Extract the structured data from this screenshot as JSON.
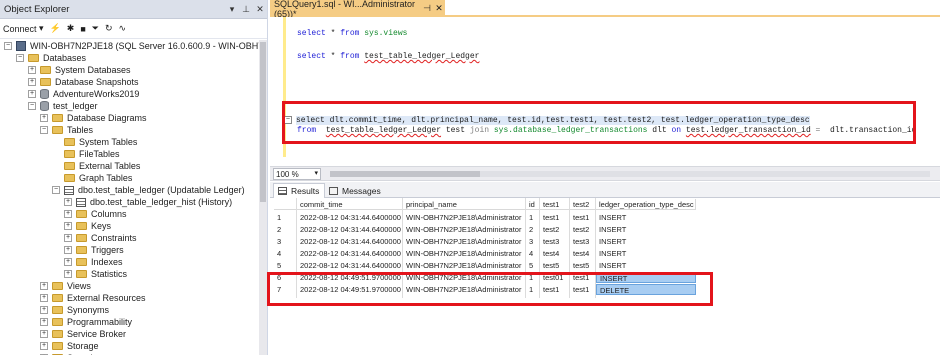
{
  "object_explorer": {
    "title": "Object Explorer",
    "connect_label": "Connect",
    "tree": [
      {
        "label": "WIN-OBH7N2PJE18 (SQL Server 16.0.600.9 - WIN-OBH7N2PJE18\\",
        "icon": "server-icon",
        "toggle": "−"
      },
      {
        "label": "Databases",
        "icon": "folder-icon",
        "toggle": "−"
      },
      {
        "label": "System Databases",
        "icon": "folder-icon",
        "toggle": "+"
      },
      {
        "label": "Database Snapshots",
        "icon": "folder-icon",
        "toggle": "+"
      },
      {
        "label": "AdventureWorks2019",
        "icon": "database-icon",
        "toggle": "+"
      },
      {
        "label": "test_ledger",
        "icon": "database-icon",
        "toggle": "−"
      },
      {
        "label": "Database Diagrams",
        "icon": "folder-icon",
        "toggle": "+"
      },
      {
        "label": "Tables",
        "icon": "folder-icon",
        "toggle": "−"
      },
      {
        "label": "System Tables",
        "icon": "folder-icon",
        "toggle": ""
      },
      {
        "label": "FileTables",
        "icon": "folder-icon",
        "toggle": ""
      },
      {
        "label": "External Tables",
        "icon": "folder-icon",
        "toggle": ""
      },
      {
        "label": "Graph Tables",
        "icon": "folder-icon",
        "toggle": ""
      },
      {
        "label": "dbo.test_table_ledger (Updatable Ledger)",
        "icon": "table-icon",
        "toggle": "−"
      },
      {
        "label": "dbo.test_table_ledger_hist (History)",
        "icon": "table-icon",
        "toggle": "+"
      },
      {
        "label": "Columns",
        "icon": "folder-icon",
        "toggle": "+"
      },
      {
        "label": "Keys",
        "icon": "folder-icon",
        "toggle": "+"
      },
      {
        "label": "Constraints",
        "icon": "folder-icon",
        "toggle": "+"
      },
      {
        "label": "Triggers",
        "icon": "folder-icon",
        "toggle": "+"
      },
      {
        "label": "Indexes",
        "icon": "folder-icon",
        "toggle": "+"
      },
      {
        "label": "Statistics",
        "icon": "folder-icon",
        "toggle": "+"
      },
      {
        "label": "Views",
        "icon": "folder-icon",
        "toggle": "+"
      },
      {
        "label": "External Resources",
        "icon": "folder-icon",
        "toggle": "+"
      },
      {
        "label": "Synonyms",
        "icon": "folder-icon",
        "toggle": "+"
      },
      {
        "label": "Programmability",
        "icon": "folder-icon",
        "toggle": "+"
      },
      {
        "label": "Service Broker",
        "icon": "folder-icon",
        "toggle": "+"
      },
      {
        "label": "Storage",
        "icon": "folder-icon",
        "toggle": "+"
      },
      {
        "label": "Security",
        "icon": "folder-icon",
        "toggle": "+"
      }
    ]
  },
  "editor": {
    "tab_label": "SQLQuery1.sql - WI...Administrator (65))*",
    "line1": {
      "kw": "select",
      "star": " * ",
      "from": "from",
      "obj": " sys.views"
    },
    "line2": {
      "kw": "select",
      "star": " * ",
      "from": "from",
      "obj": "test_table_ledger_Ledger"
    },
    "line3": "select dlt.commit_time, dlt.principal_name, test.id,test.test1, test.test2, test.ledger_operation_type_desc",
    "line4": {
      "from": "from",
      "t1": "test_table_ledger_Ledger",
      "alias": " test ",
      "join": "join",
      "sys": " sys.database_ledger_transactions",
      "dlt": " dlt ",
      "on": "on",
      "cond1": "test.ledger_transaction_id",
      "eq": " = ",
      "cond2": " dlt.transaction_id"
    },
    "zoom": "100 %"
  },
  "results": {
    "tabs": [
      "Results",
      "Messages"
    ],
    "columns": [
      "commit_time",
      "principal_name",
      "id",
      "test1",
      "test2",
      "ledger_operation_type_desc"
    ],
    "rows": [
      [
        "1",
        "2022-08-12 04:31:44.6400000",
        "WIN-OBH7N2PJE18\\Administrator",
        "1",
        "test1",
        "test1",
        "INSERT"
      ],
      [
        "2",
        "2022-08-12 04:31:44.6400000",
        "WIN-OBH7N2PJE18\\Administrator",
        "2",
        "test2",
        "test2",
        "INSERT"
      ],
      [
        "3",
        "2022-08-12 04:31:44.6400000",
        "WIN-OBH7N2PJE18\\Administrator",
        "3",
        "test3",
        "test3",
        "INSERT"
      ],
      [
        "4",
        "2022-08-12 04:31:44.6400000",
        "WIN-OBH7N2PJE18\\Administrator",
        "4",
        "test4",
        "test4",
        "INSERT"
      ],
      [
        "5",
        "2022-08-12 04:31:44.6400000",
        "WIN-OBH7N2PJE18\\Administrator",
        "5",
        "test5",
        "test5",
        "INSERT"
      ],
      [
        "6",
        "2022-08-12 04:49:51.9700000",
        "WIN-OBH7N2PJE18\\Administrator",
        "1",
        "test01",
        "test1",
        "INSERT"
      ],
      [
        "7",
        "2022-08-12 04:49:51.9700000",
        "WIN-OBH7N2PJE18\\Administrator",
        "1",
        "test1",
        "test1",
        "DELETE"
      ]
    ]
  },
  "colors": {
    "highlight_box": "#e3141b",
    "active_tab": "#f5cc84",
    "selected_cell": "#a8cdf2"
  }
}
